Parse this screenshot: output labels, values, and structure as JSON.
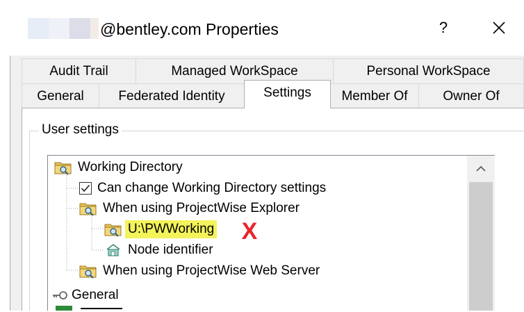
{
  "window": {
    "title": "@bentley.com Properties",
    "help_label": "?",
    "close_label": "✕"
  },
  "tabs_row1": [
    {
      "label": "Audit Trail"
    },
    {
      "label": "Managed WorkSpace"
    },
    {
      "label": "Personal WorkSpace"
    }
  ],
  "tabs_row2": [
    {
      "label": "General"
    },
    {
      "label": "Federated Identity"
    },
    {
      "label": "Settings",
      "active": true
    },
    {
      "label": "Member Of"
    },
    {
      "label": "Owner Of"
    }
  ],
  "group": {
    "label": "User settings"
  },
  "tree": {
    "items": [
      {
        "label": "Working Directory",
        "icon": "folder-search-icon"
      },
      {
        "label": "Can change Working Directory settings",
        "icon": "checkbox-checked"
      },
      {
        "label": "When using ProjectWise Explorer",
        "icon": "folder-search-icon"
      },
      {
        "label": "U:\\PWWorking",
        "icon": "folder-search-icon",
        "highlighted": true
      },
      {
        "label": "Node identifier",
        "icon": "network-node-icon"
      },
      {
        "label": "When using ProjectWise Web Server",
        "icon": "folder-search-icon"
      },
      {
        "label": "General",
        "icon": "key-icon"
      }
    ]
  },
  "annotation": {
    "mark": "X",
    "color": "#e8252a"
  },
  "colors": {
    "highlight": "#f3f35a",
    "tree_line": "#a0a0a0"
  }
}
